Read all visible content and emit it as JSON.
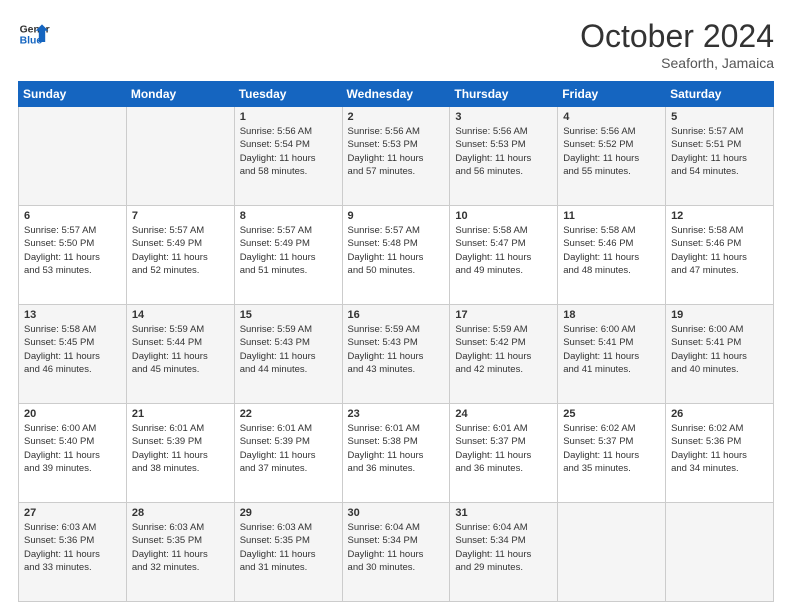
{
  "header": {
    "logo_general": "General",
    "logo_blue": "Blue",
    "month": "October 2024",
    "location": "Seaforth, Jamaica"
  },
  "weekdays": [
    "Sunday",
    "Monday",
    "Tuesday",
    "Wednesday",
    "Thursday",
    "Friday",
    "Saturday"
  ],
  "weeks": [
    [
      {
        "day": "",
        "info": ""
      },
      {
        "day": "",
        "info": ""
      },
      {
        "day": "1",
        "info": "Sunrise: 5:56 AM\nSunset: 5:54 PM\nDaylight: 11 hours\nand 58 minutes."
      },
      {
        "day": "2",
        "info": "Sunrise: 5:56 AM\nSunset: 5:53 PM\nDaylight: 11 hours\nand 57 minutes."
      },
      {
        "day": "3",
        "info": "Sunrise: 5:56 AM\nSunset: 5:53 PM\nDaylight: 11 hours\nand 56 minutes."
      },
      {
        "day": "4",
        "info": "Sunrise: 5:56 AM\nSunset: 5:52 PM\nDaylight: 11 hours\nand 55 minutes."
      },
      {
        "day": "5",
        "info": "Sunrise: 5:57 AM\nSunset: 5:51 PM\nDaylight: 11 hours\nand 54 minutes."
      }
    ],
    [
      {
        "day": "6",
        "info": "Sunrise: 5:57 AM\nSunset: 5:50 PM\nDaylight: 11 hours\nand 53 minutes."
      },
      {
        "day": "7",
        "info": "Sunrise: 5:57 AM\nSunset: 5:49 PM\nDaylight: 11 hours\nand 52 minutes."
      },
      {
        "day": "8",
        "info": "Sunrise: 5:57 AM\nSunset: 5:49 PM\nDaylight: 11 hours\nand 51 minutes."
      },
      {
        "day": "9",
        "info": "Sunrise: 5:57 AM\nSunset: 5:48 PM\nDaylight: 11 hours\nand 50 minutes."
      },
      {
        "day": "10",
        "info": "Sunrise: 5:58 AM\nSunset: 5:47 PM\nDaylight: 11 hours\nand 49 minutes."
      },
      {
        "day": "11",
        "info": "Sunrise: 5:58 AM\nSunset: 5:46 PM\nDaylight: 11 hours\nand 48 minutes."
      },
      {
        "day": "12",
        "info": "Sunrise: 5:58 AM\nSunset: 5:46 PM\nDaylight: 11 hours\nand 47 minutes."
      }
    ],
    [
      {
        "day": "13",
        "info": "Sunrise: 5:58 AM\nSunset: 5:45 PM\nDaylight: 11 hours\nand 46 minutes."
      },
      {
        "day": "14",
        "info": "Sunrise: 5:59 AM\nSunset: 5:44 PM\nDaylight: 11 hours\nand 45 minutes."
      },
      {
        "day": "15",
        "info": "Sunrise: 5:59 AM\nSunset: 5:43 PM\nDaylight: 11 hours\nand 44 minutes."
      },
      {
        "day": "16",
        "info": "Sunrise: 5:59 AM\nSunset: 5:43 PM\nDaylight: 11 hours\nand 43 minutes."
      },
      {
        "day": "17",
        "info": "Sunrise: 5:59 AM\nSunset: 5:42 PM\nDaylight: 11 hours\nand 42 minutes."
      },
      {
        "day": "18",
        "info": "Sunrise: 6:00 AM\nSunset: 5:41 PM\nDaylight: 11 hours\nand 41 minutes."
      },
      {
        "day": "19",
        "info": "Sunrise: 6:00 AM\nSunset: 5:41 PM\nDaylight: 11 hours\nand 40 minutes."
      }
    ],
    [
      {
        "day": "20",
        "info": "Sunrise: 6:00 AM\nSunset: 5:40 PM\nDaylight: 11 hours\nand 39 minutes."
      },
      {
        "day": "21",
        "info": "Sunrise: 6:01 AM\nSunset: 5:39 PM\nDaylight: 11 hours\nand 38 minutes."
      },
      {
        "day": "22",
        "info": "Sunrise: 6:01 AM\nSunset: 5:39 PM\nDaylight: 11 hours\nand 37 minutes."
      },
      {
        "day": "23",
        "info": "Sunrise: 6:01 AM\nSunset: 5:38 PM\nDaylight: 11 hours\nand 36 minutes."
      },
      {
        "day": "24",
        "info": "Sunrise: 6:01 AM\nSunset: 5:37 PM\nDaylight: 11 hours\nand 36 minutes."
      },
      {
        "day": "25",
        "info": "Sunrise: 6:02 AM\nSunset: 5:37 PM\nDaylight: 11 hours\nand 35 minutes."
      },
      {
        "day": "26",
        "info": "Sunrise: 6:02 AM\nSunset: 5:36 PM\nDaylight: 11 hours\nand 34 minutes."
      }
    ],
    [
      {
        "day": "27",
        "info": "Sunrise: 6:03 AM\nSunset: 5:36 PM\nDaylight: 11 hours\nand 33 minutes."
      },
      {
        "day": "28",
        "info": "Sunrise: 6:03 AM\nSunset: 5:35 PM\nDaylight: 11 hours\nand 32 minutes."
      },
      {
        "day": "29",
        "info": "Sunrise: 6:03 AM\nSunset: 5:35 PM\nDaylight: 11 hours\nand 31 minutes."
      },
      {
        "day": "30",
        "info": "Sunrise: 6:04 AM\nSunset: 5:34 PM\nDaylight: 11 hours\nand 30 minutes."
      },
      {
        "day": "31",
        "info": "Sunrise: 6:04 AM\nSunset: 5:34 PM\nDaylight: 11 hours\nand 29 minutes."
      },
      {
        "day": "",
        "info": ""
      },
      {
        "day": "",
        "info": ""
      }
    ]
  ]
}
